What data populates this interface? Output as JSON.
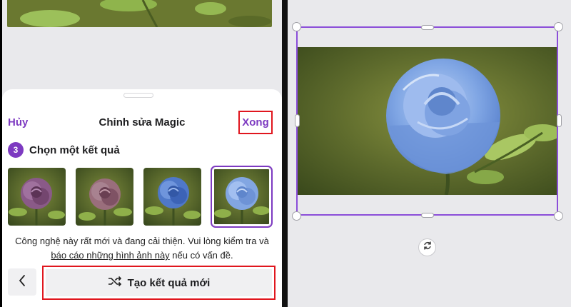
{
  "sheet": {
    "cancel_label": "Hủy",
    "title": "Chỉnh sửa Magic",
    "done_label": "Xong"
  },
  "step": {
    "number": "3",
    "label": "Chọn một kết quả"
  },
  "results": [
    {
      "name": "purple-rose",
      "selected": false
    },
    {
      "name": "mauve-rose",
      "selected": false
    },
    {
      "name": "blue-rose",
      "selected": false
    },
    {
      "name": "light-blue-rose",
      "selected": true
    }
  ],
  "notice": {
    "text_before": "Công nghệ này rất mới và đang cải thiện. Vui lòng kiểm tra và ",
    "link_text": "báo cáo những hình ảnh này",
    "text_after": " nếu có vấn đề."
  },
  "actions": {
    "back_icon": "chevron-left-icon",
    "generate_icon": "shuffle-icon",
    "generate_label": "Tạo kết quả mới"
  },
  "editor": {
    "rotate_icon": "rotate-icon"
  },
  "colors": {
    "accent": "#7d3ac1",
    "highlight_box": "#e0161e",
    "selection_frame": "#8b4ed9"
  }
}
